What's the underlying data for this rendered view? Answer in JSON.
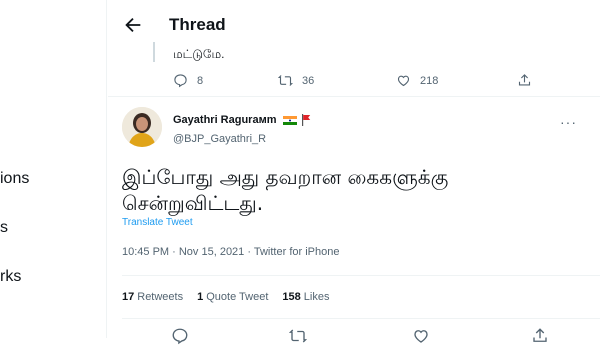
{
  "nav": {
    "items": [
      {
        "label": "ions"
      },
      {
        "label": "s"
      },
      {
        "label": "rks"
      }
    ]
  },
  "header": {
    "title": "Thread"
  },
  "prev_tweet": {
    "text": "மட்டுமே.",
    "replies": "8",
    "retweets": "36",
    "likes": "218"
  },
  "tweet": {
    "display_name": "Gayathri Ragurамm",
    "handle": "@BJP_Gayathri_R",
    "more": "···",
    "text_line1": "இப்போது அது தவறான கைகளுக்கு",
    "text_line2": "சென்றுவிட்டது.",
    "translate": "Translate Tweet",
    "meta": "10:45 PM · Nov 15, 2021 · Twitter for iPhone",
    "retweets_count": "17",
    "retweets_label": "Retweets",
    "quotes_count": "1",
    "quotes_label": "Quote Tweet",
    "likes_count": "158",
    "likes_label": "Likes"
  },
  "colors": {
    "accent": "#1d9bf0",
    "muted": "#536471",
    "border": "#eff3f4"
  },
  "icons": [
    "back-arrow-icon",
    "reply-icon",
    "retweet-icon",
    "like-icon",
    "share-icon",
    "india-flag-icon",
    "red-flag-icon"
  ]
}
